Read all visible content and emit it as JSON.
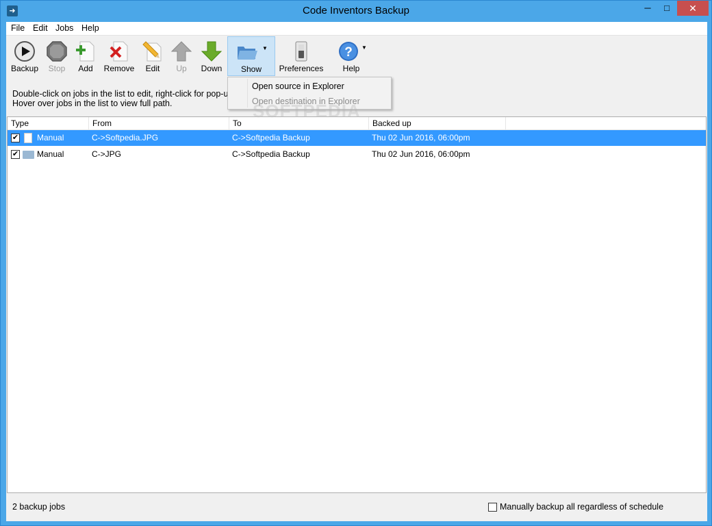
{
  "window": {
    "title": "Code Inventors Backup",
    "minimize_glyph": "─",
    "maximize_glyph": "□",
    "close_glyph": "✕"
  },
  "menu": [
    "File",
    "Edit",
    "Jobs",
    "Help"
  ],
  "toolbar": {
    "backup": "Backup",
    "stop": "Stop",
    "add": "Add",
    "remove": "Remove",
    "edit": "Edit",
    "up": "Up",
    "down": "Down",
    "show": "Show",
    "preferences": "Preferences",
    "help": "Help"
  },
  "hint": {
    "line1": "Double-click on jobs in the list to edit, right-click for pop-up",
    "line2": "Hover over jobs in the list to view full path."
  },
  "show_menu": {
    "items": [
      {
        "label": "Open source in Explorer",
        "enabled": true
      },
      {
        "label": "Open destination in Explorer",
        "enabled": false
      }
    ]
  },
  "list": {
    "columns": [
      "Type",
      "From",
      "To",
      "Backed up"
    ],
    "rows": [
      {
        "type": "Manual",
        "from": "C->Softpedia.JPG",
        "to": "C->Softpedia Backup",
        "backed_up": "Thu 02 Jun 2016, 06:00pm",
        "checked": true,
        "selected": true,
        "icon": "file-icon"
      },
      {
        "type": "Manual",
        "from": "C->JPG",
        "to": "C->Softpedia Backup",
        "backed_up": "Thu 02 Jun 2016, 06:00pm",
        "checked": true,
        "selected": false,
        "icon": "folder-icon"
      }
    ]
  },
  "status": {
    "jobs_count": "2 backup jobs",
    "manual_all_label": "Manually backup all regardless of schedule"
  },
  "watermark": "SOFTPEDIA",
  "colors": {
    "accent": "#4ba7e8",
    "selection": "#3399ff",
    "close": "#c74f4f"
  }
}
